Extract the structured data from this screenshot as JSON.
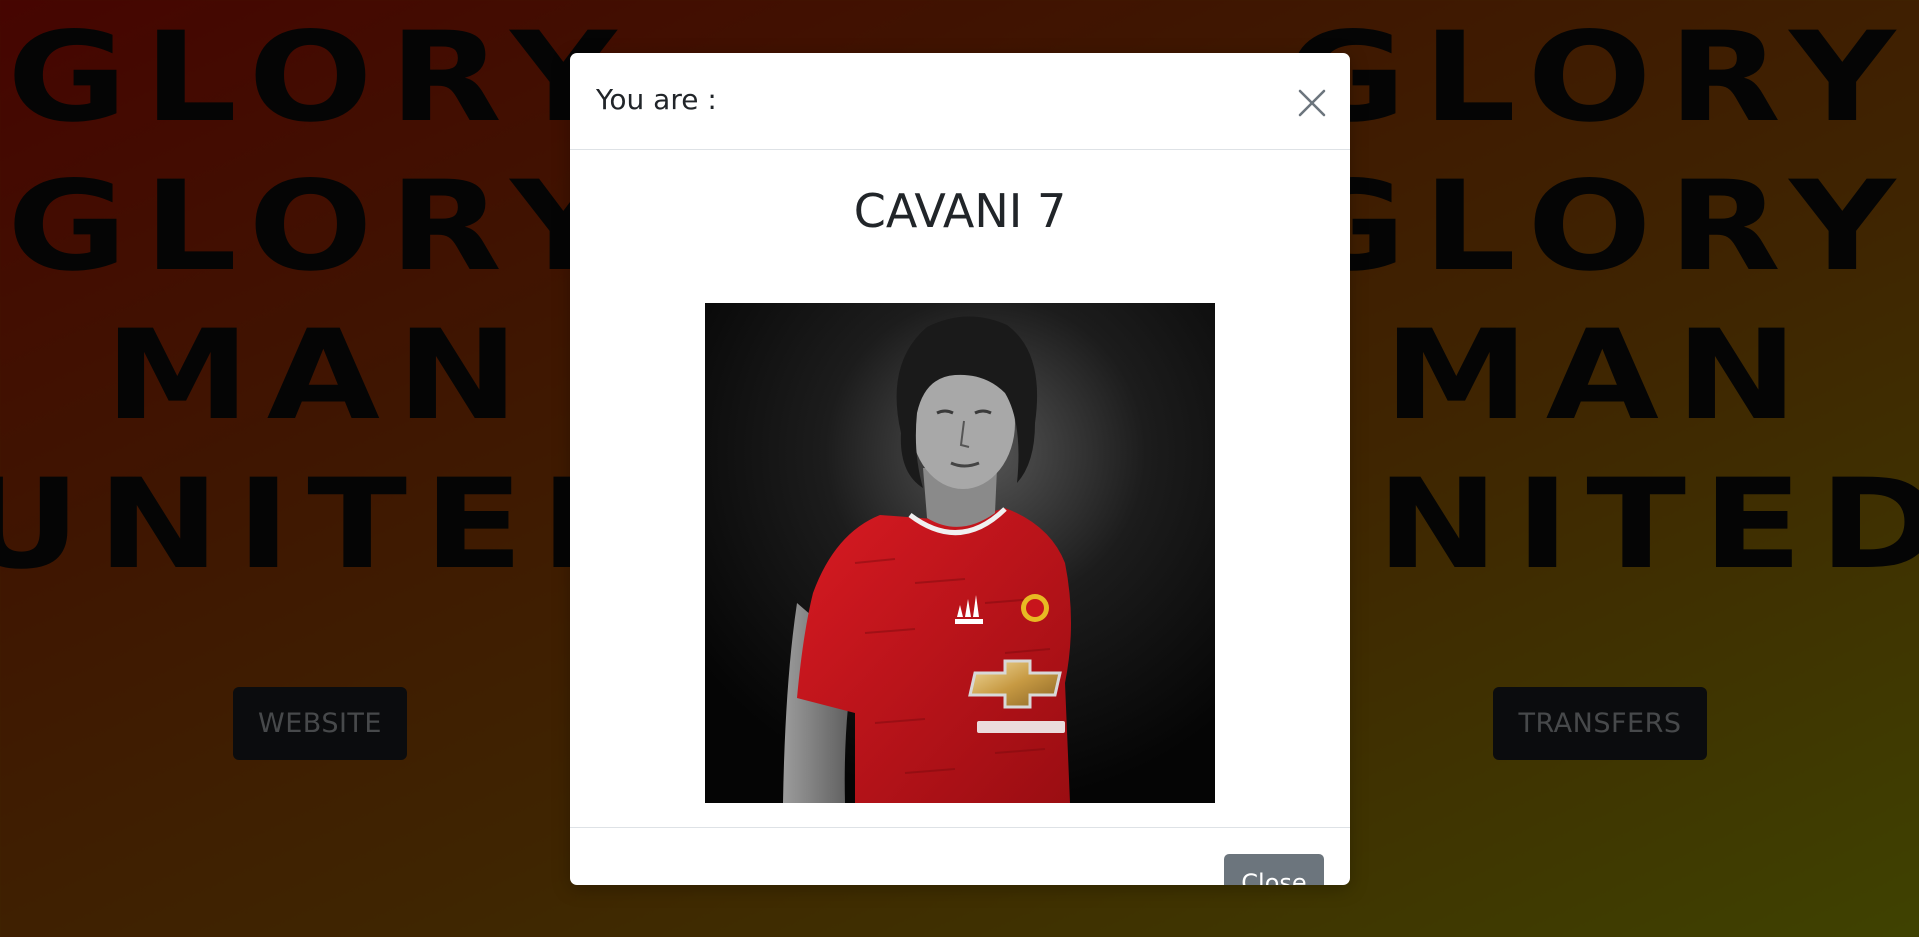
{
  "background": {
    "left_slogan": [
      "GLORY",
      "GLORY",
      "MAN",
      "UNITED"
    ],
    "right_slogan": [
      "GLORY",
      "GLORY",
      "MAN",
      "UNITED"
    ],
    "website_button": "WEBSITE",
    "transfers_button": "TRANSFERS"
  },
  "modal": {
    "title": "You are :",
    "player_name": "CAVANI 7",
    "photo_alt": "CAVANI 7",
    "close_button": "Close",
    "close_icon": "close-icon"
  },
  "colors": {
    "gradient_start": "#8c0a02",
    "gradient_end": "#7f8502",
    "side_button_bg": "#17191c",
    "close_button_bg": "#6c757d",
    "jersey_red": "#c8141c"
  }
}
